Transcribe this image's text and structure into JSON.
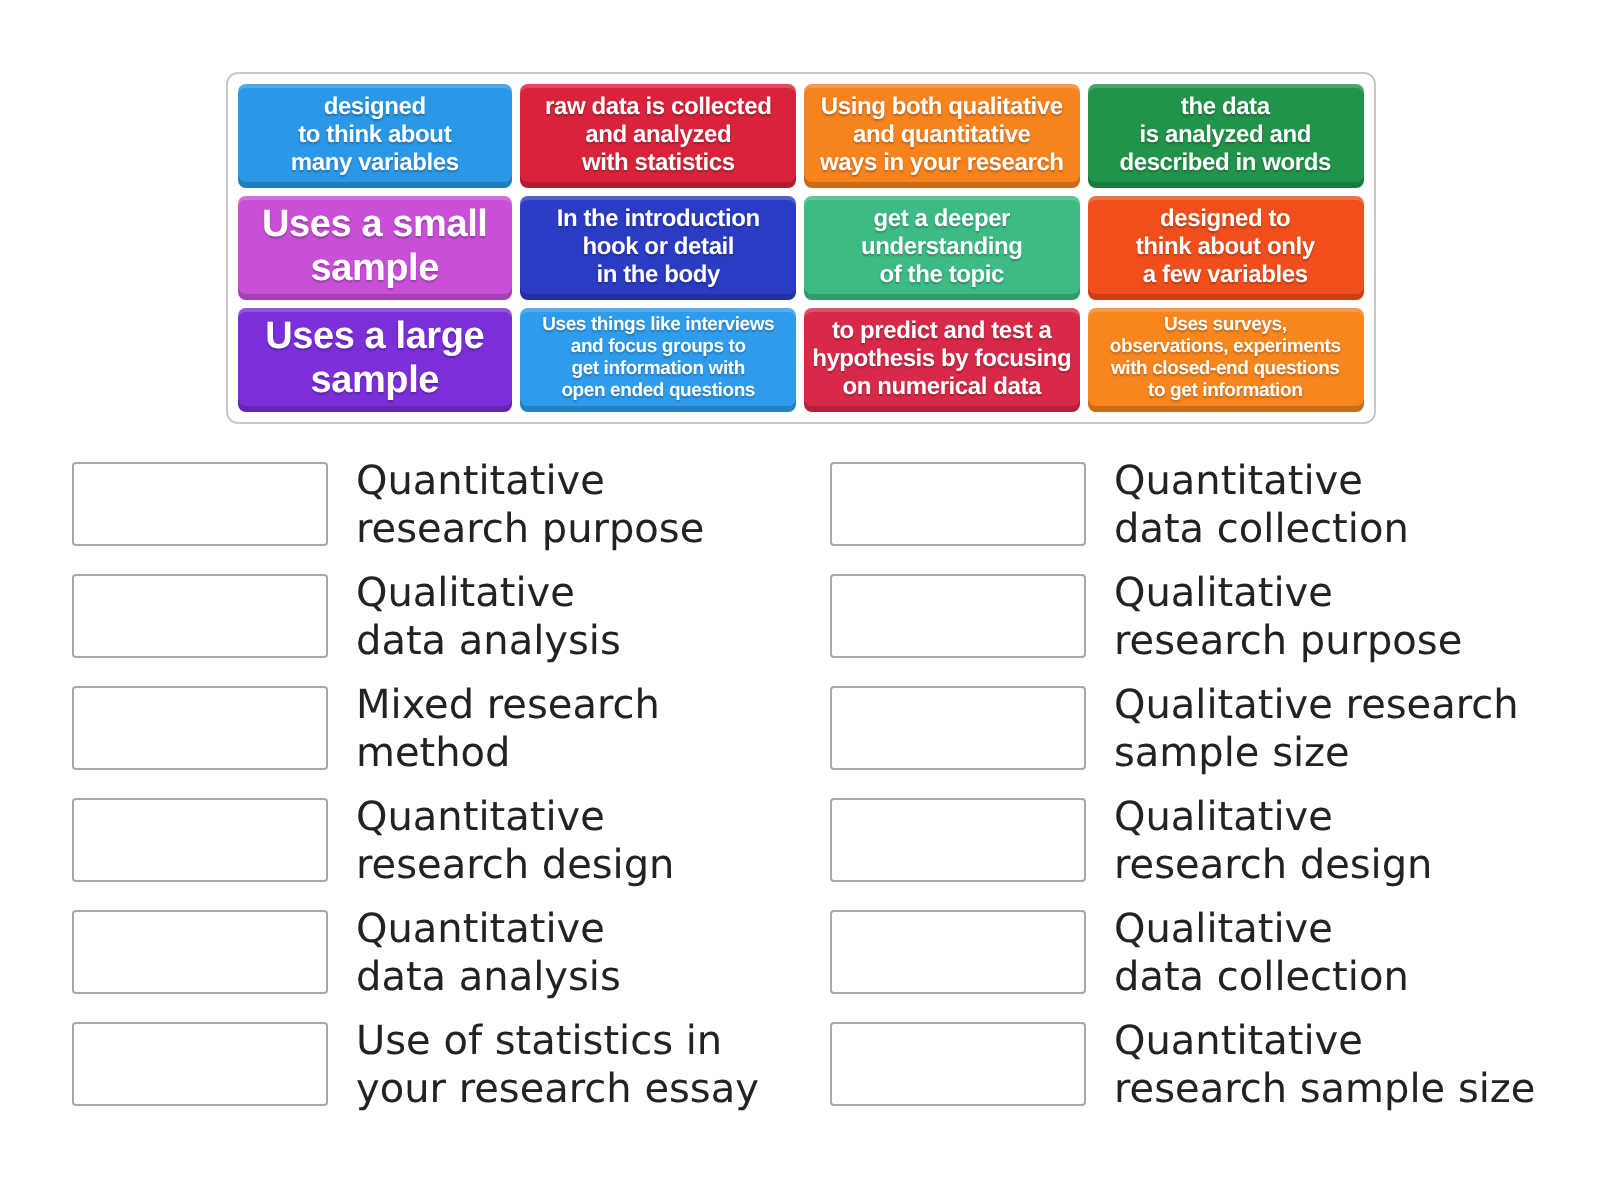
{
  "tiles": [
    {
      "text": "designed\nto think about\nmany variables",
      "color": "#2a98e6"
    },
    {
      "text": "raw data is collected\nand analyzed\nwith statistics",
      "color": "#d9233a"
    },
    {
      "text": "Using both qualitative\nand quantitative\nways in your research",
      "color": "#f7831f"
    },
    {
      "text": "the data\nis analyzed and\ndescribed in words",
      "color": "#22934a"
    },
    {
      "text": "Uses a small\nsample",
      "color": "#c94fd8"
    },
    {
      "text": "In the introduction\nhook or detail\nin the body",
      "color": "#2b3cc4"
    },
    {
      "text": "get a deeper\nunderstanding\nof the topic",
      "color": "#3dbb84"
    },
    {
      "text": "designed to\nthink about only\na few variables",
      "color": "#f04f1c"
    },
    {
      "text": "Uses a large\nsample",
      "color": "#7a2fd9"
    },
    {
      "text": "Uses things like interviews\nand focus groups to\nget information with\nopen ended questions",
      "color": "#2f9ceb"
    },
    {
      "text": "to predict and test a\nhypothesis by focusing\non numerical data",
      "color": "#d82a48"
    },
    {
      "text": "Uses surveys,\nobservations, experiments\nwith closed-end questions\nto get information",
      "color": "#f7861f"
    }
  ],
  "targets": [
    {
      "label": "Quantitative\nresearch purpose"
    },
    {
      "label": "Quantitative\ndata collection"
    },
    {
      "label": "Qualitative\ndata analysis"
    },
    {
      "label": "Qualitative\nresearch purpose"
    },
    {
      "label": "Mixed research\nmethod"
    },
    {
      "label": "Qualitative research\nsample size"
    },
    {
      "label": "Quantitative\nresearch design"
    },
    {
      "label": "Qualitative\nresearch design"
    },
    {
      "label": "Quantitative\ndata analysis"
    },
    {
      "label": "Qualitative\ndata collection"
    },
    {
      "label": "Use of statistics in\nyour research essay"
    },
    {
      "label": "Quantitative\nresearch sample size"
    }
  ]
}
